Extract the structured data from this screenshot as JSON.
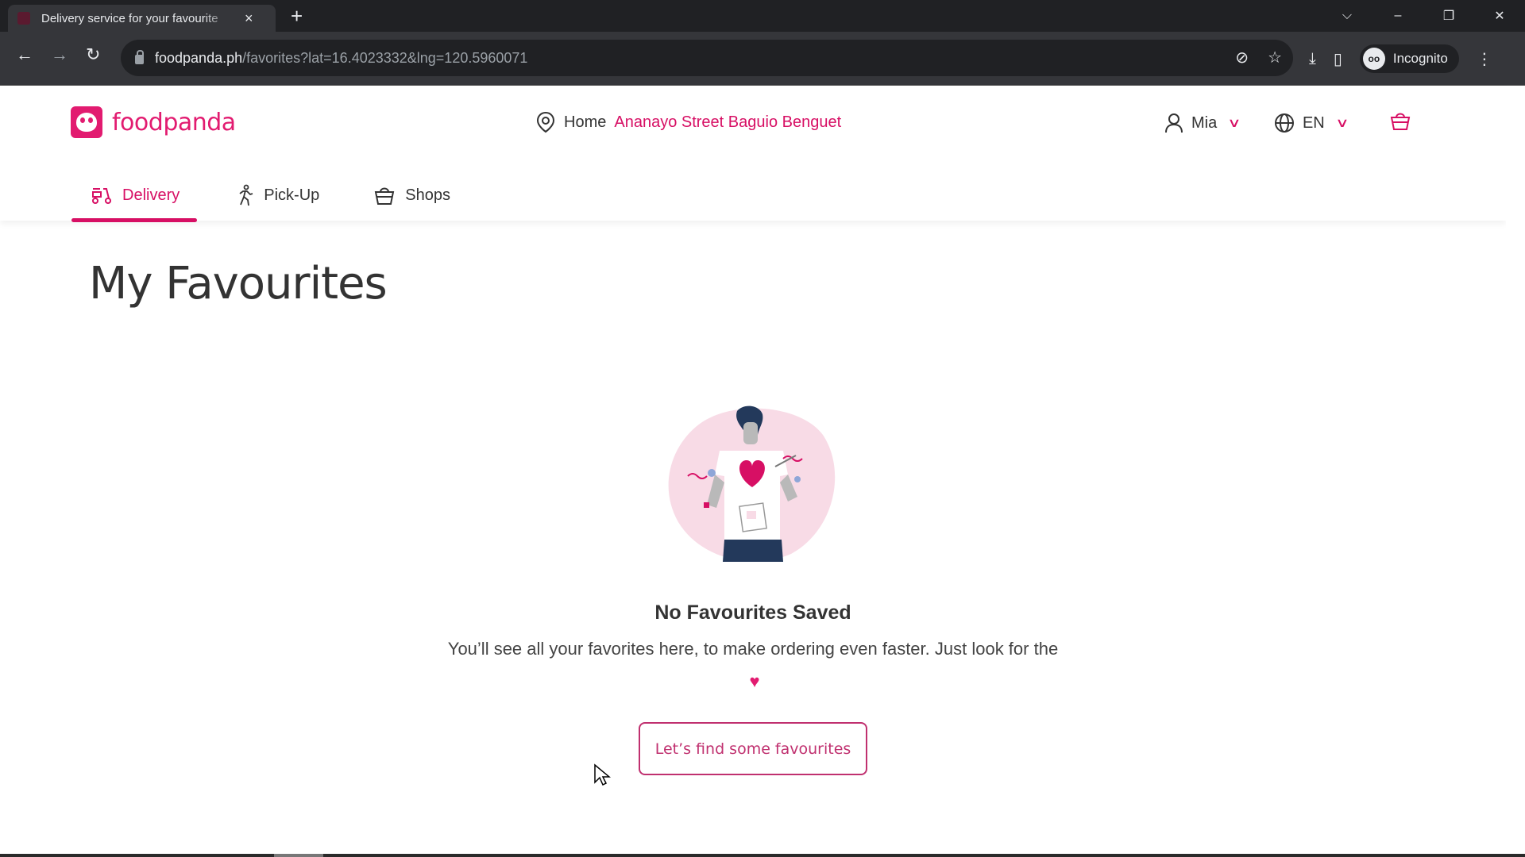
{
  "browser": {
    "tab_title": "Delivery service for your favourite",
    "tab_close": "×",
    "new_tab": "+",
    "url_host": "foodpanda.ph",
    "url_path": "/favorites?lat=16.4023332&lng=120.5960071",
    "incognito_label": "Incognito",
    "window_controls": {
      "dropdown": "⌵",
      "minimize": "–",
      "restore": "❐",
      "close": "✕"
    },
    "nav": {
      "back": "←",
      "forward": "→",
      "reload": "↻"
    },
    "toolbar_icons": {
      "eye_off": "⊘",
      "star": "☆",
      "download": "⤓",
      "sidepanel": "▯",
      "menu": "⋮"
    }
  },
  "site": {
    "brand": "foodpanda",
    "brand_color": "#e21b70",
    "address_label": "Home",
    "address_value": "Ananayo Street Baguio Benguet",
    "user_name": "Mia",
    "language": "EN",
    "nav_tabs": [
      {
        "label": "Delivery",
        "icon": "scooter-icon",
        "active": true
      },
      {
        "label": "Pick-Up",
        "icon": "walking-person-icon",
        "active": false
      },
      {
        "label": "Shops",
        "icon": "shopping-basket-icon",
        "active": false
      }
    ]
  },
  "main": {
    "page_title": "My Favourites",
    "empty_title": "No Favourites Saved",
    "empty_description": "You’ll see all your favorites here, to make ordering even faster. Just look for the",
    "heart_glyph": "♥",
    "cta_label": "Let’s find some favourites"
  }
}
